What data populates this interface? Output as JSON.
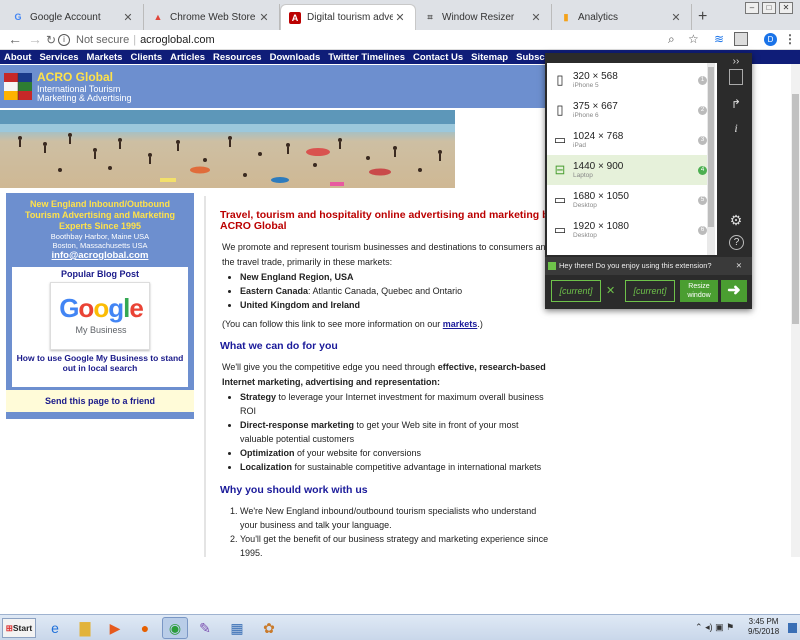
{
  "browser": {
    "tabs": [
      {
        "title": "Google Account",
        "favicon": "G"
      },
      {
        "title": "Chrome Web Store - window resi",
        "favicon": "▲"
      },
      {
        "title": "Digital tourism advertising marke",
        "favicon": "A"
      },
      {
        "title": "Window Resizer",
        "favicon": "⌗"
      },
      {
        "title": "Analytics",
        "favicon": "▮"
      }
    ],
    "new_tab": "+",
    "address": {
      "security": "Not secure",
      "url": "acroglobal.com"
    },
    "profile_initial": "D"
  },
  "site": {
    "nav": [
      "About",
      "Services",
      "Markets",
      "Clients",
      "Articles",
      "Resources",
      "Downloads",
      "Twitter Timelines",
      "Contact Us",
      "Sitemap",
      "Subscribe to David"
    ],
    "brand": "ACRO Global",
    "tagline_1": "International Tourism",
    "tagline_2": "Marketing & Advertising",
    "sidebar": {
      "headline": "New England Inbound/Outbound Tourism Advertising and Marketing Experts Since 1995",
      "loc1": "Boothbay Harbor, Maine USA",
      "loc2": "Boston, Massachusetts USA",
      "email": "info@acroglobal.com",
      "popular_title": "Popular Blog Post",
      "google_word": "Google",
      "google_sub": "My Business",
      "post_title": "How to use Google My Business to stand out in local search",
      "send": "Send this page to a friend"
    },
    "main": {
      "title": "Travel, tourism and hospitality online advertising and marketing by ACRO Global",
      "intro": "We promote and represent tourism businesses and destinations to consumers and the travel trade, primarily in these markets:",
      "markets": [
        {
          "bold": "New England Region, USA",
          "rest": ""
        },
        {
          "bold": "Eastern Canada",
          "rest": ": Atlantic Canada, Quebec and Ontario"
        },
        {
          "bold": "United Kingdom and Ireland",
          "rest": ""
        }
      ],
      "follow_pre": "(You can follow this link to see more information on our ",
      "follow_link": "markets",
      "follow_post": ".)",
      "h_what": "What we can do for you",
      "what_pre": "We'll give you the competitive edge you need through ",
      "what_bold": "effective, research-based Internet marketing, advertising and representation:",
      "services": [
        {
          "bold": "Strategy",
          "rest": " to leverage your Internet investment for maximum overall business ROI"
        },
        {
          "bold": "Direct-response marketing",
          "rest": " to get your Web site in front of your most valuable potential customers"
        },
        {
          "bold": "Optimization",
          "rest": " of your website for conversions"
        },
        {
          "bold": "Localization",
          "rest": " for sustainable competitive advantage in international markets"
        }
      ],
      "h_why": "Why you should work with us",
      "reasons": [
        "We're New England inbound/outbound tourism specialists who understand your business and talk your language.",
        "You'll get the benefit of our business strategy and marketing experience since 1995."
      ]
    }
  },
  "extension": {
    "devices": [
      {
        "res": "320 × 568",
        "name": "iPhone 5",
        "num": "1",
        "icon": "phone-icon"
      },
      {
        "res": "375 × 667",
        "name": "iPhone 6",
        "num": "2",
        "icon": "phone-icon"
      },
      {
        "res": "1024 × 768",
        "name": "iPad",
        "num": "3",
        "icon": "tablet-icon"
      },
      {
        "res": "1440 × 900",
        "name": "Laptop",
        "num": "4",
        "icon": "laptop-icon"
      },
      {
        "res": "1680 × 1050",
        "name": "Desktop",
        "num": "5",
        "icon": "monitor-icon"
      },
      {
        "res": "1920 × 1080",
        "name": "Desktop",
        "num": "6",
        "icon": "monitor-icon"
      }
    ],
    "message": "Hey there! Do you enjoy using this extension?",
    "width_ph": "[current]",
    "height_ph": "[current]",
    "resize_1": "Resize",
    "resize_2": "window",
    "accent": "#6ec24a"
  },
  "taskbar": {
    "start": "Start",
    "time": "3:45 PM",
    "date": "9/5/2018"
  }
}
